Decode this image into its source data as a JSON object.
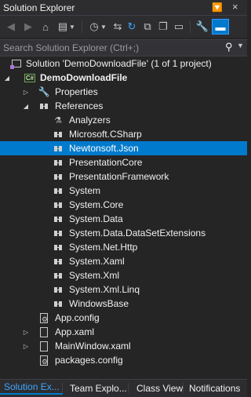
{
  "window": {
    "title": "Solution Explorer"
  },
  "search": {
    "placeholder": "Search Solution Explorer (Ctrl+;)"
  },
  "tree": {
    "solution": "Solution 'DemoDownloadFile' (1 of 1 project)",
    "project": "DemoDownloadFile",
    "properties": "Properties",
    "references": "References",
    "analyzers": "Analyzers",
    "refs": [
      "Microsoft.CSharp",
      "Newtonsoft.Json",
      "PresentationCore",
      "PresentationFramework",
      "System",
      "System.Core",
      "System.Data",
      "System.Data.DataSetExtensions",
      "System.Net.Http",
      "System.Xaml",
      "System.Xml",
      "System.Xml.Linq",
      "WindowsBase"
    ],
    "selected_ref": "Newtonsoft.Json",
    "files": [
      "App.config",
      "App.xaml",
      "MainWindow.xaml",
      "packages.config"
    ]
  },
  "tabs": [
    "Solution Ex...",
    "Team Explo...",
    "Class View",
    "Notifications"
  ],
  "active_tab": "Solution Ex...",
  "colors": {
    "accent": "#007acc",
    "background": "#252526",
    "toolbar": "#2d2d30"
  }
}
